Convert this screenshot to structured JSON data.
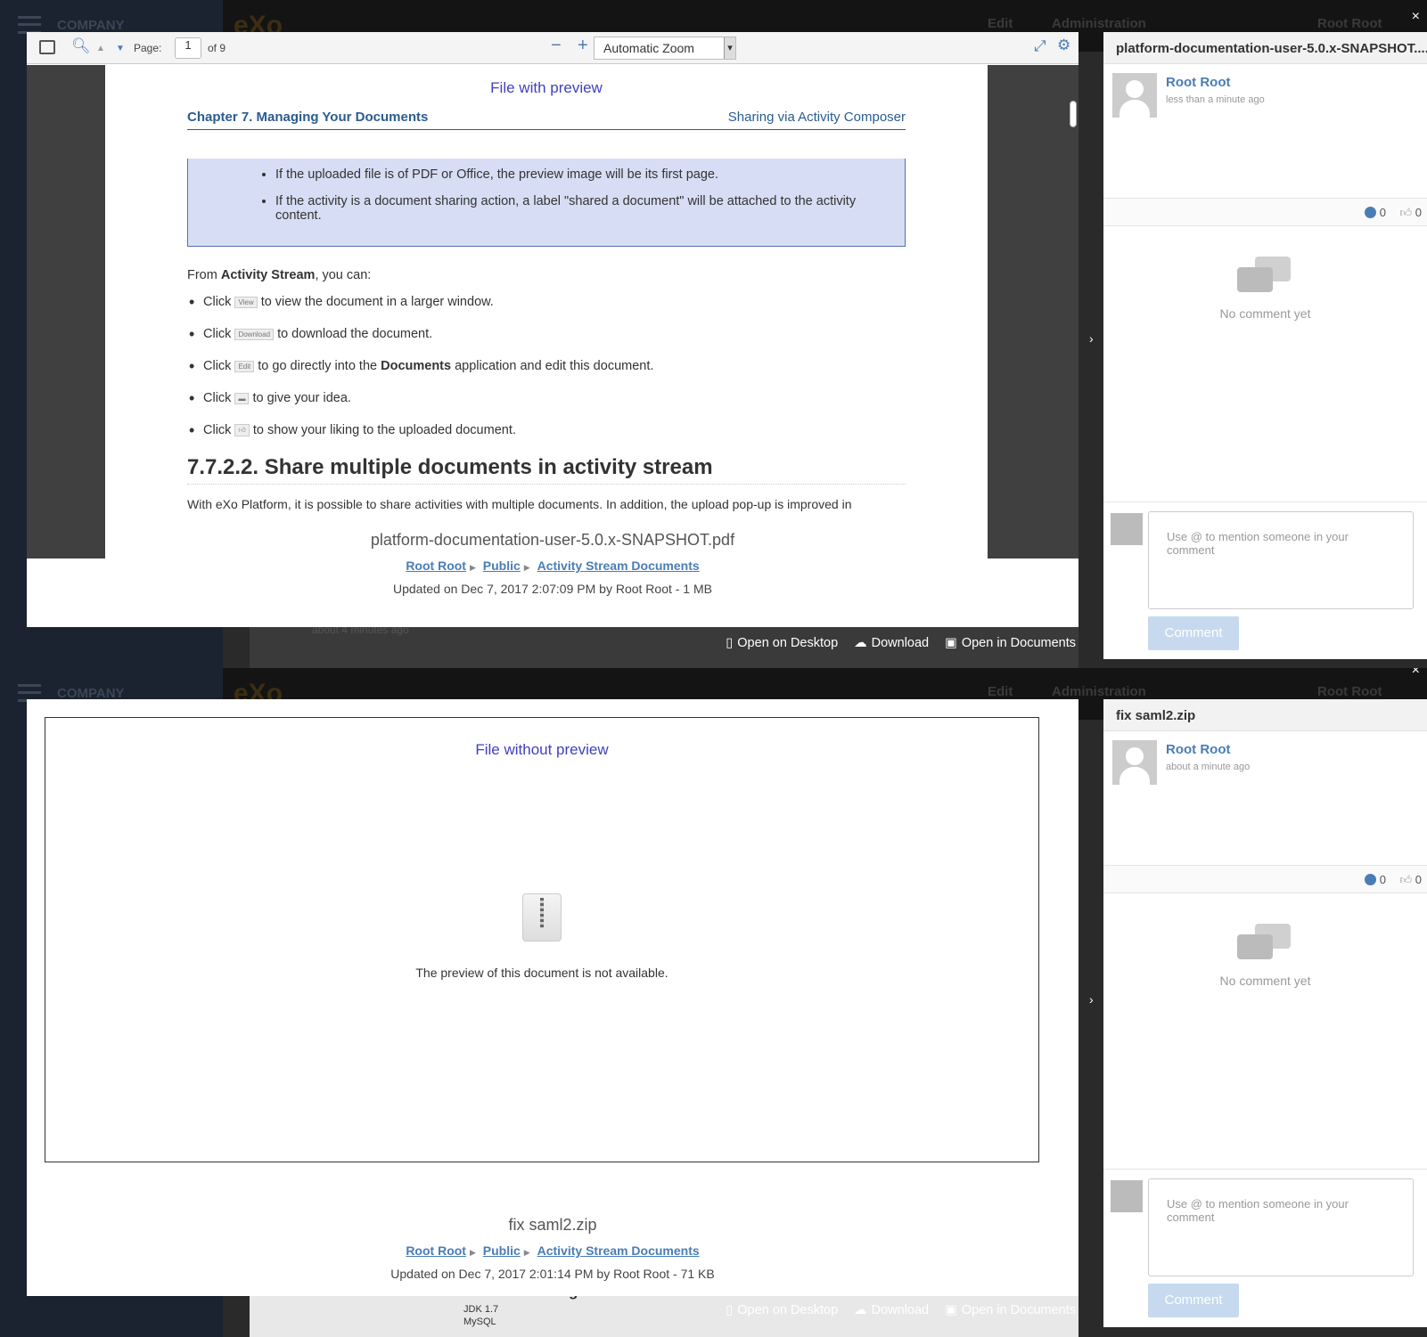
{
  "background": {
    "company": "COMPANY",
    "logo": "eXo",
    "nav": {
      "edit": "Edit",
      "administration": "Administration",
      "user": "Root Root"
    },
    "ghost_time": "about 4 minutes ago",
    "ghost_heading": "Tools and Technologies",
    "ghost_items": [
      "JDK 1.7",
      "MySQL"
    ]
  },
  "preview1": {
    "toolbar": {
      "page_label": "Page:",
      "page_value": "1",
      "page_total": "of 9",
      "zoom": "Automatic Zoom"
    },
    "doc": {
      "heading": "File with preview",
      "chapter": "Chapter 7. Managing Your Documents",
      "section_right": "Sharing via Activity Composer",
      "note_items": [
        "If the uploaded file is of PDF or Office, the preview image will be its first page.",
        "If the activity is a document sharing action, a label \"shared a document\" will be attached to the activity content."
      ],
      "intro_pre": "From ",
      "intro_bold": "Activity Stream",
      "intro_post": ", you can:",
      "click": "Click",
      "item_view_btn": "View",
      "item_view": "to view the document in a larger window.",
      "item_download_btn": "Download",
      "item_download": "to download the document.",
      "item_edit_btn": "Edit",
      "item_edit_pre": "to go directly into the ",
      "item_edit_bold": "Documents",
      "item_edit_post": " application and edit this document.",
      "item_idea": "to give your idea.",
      "item_like": "to show your liking to the uploaded document.",
      "section_title": "7.7.2.2. Share multiple documents in activity stream",
      "cut_text": "With eXo Platform, it is possible to share activities with multiple documents. In addition, the upload pop-up is improved in"
    },
    "file": {
      "name": "platform-documentation-user-5.0.x-SNAPSHOT.pdf",
      "breadcrumb": [
        "Root Root",
        "Public",
        "Activity Stream Documents"
      ],
      "updated": "Updated on Dec 7, 2017 2:07:09 PM by Root Root - 1 MB"
    },
    "side": {
      "title": "platform-documentation-user-5.0.x-SNAPSHOT....",
      "author": "Root Root",
      "time": "less than a minute ago",
      "comments": "0",
      "likes": "0",
      "no_comment": "No comment yet",
      "comment_placeholder": "Use @ to mention someone in your comment",
      "comment_button": "Comment"
    }
  },
  "preview2": {
    "heading": "File without preview",
    "message": "The preview of this document is not available.",
    "file": {
      "name": "fix saml2.zip",
      "breadcrumb": [
        "Root Root",
        "Public",
        "Activity Stream Documents"
      ],
      "updated": "Updated on Dec 7, 2017 2:01:14 PM by Root Root - 71 KB"
    },
    "side": {
      "title": "fix saml2.zip",
      "author": "Root Root",
      "time": "about a minute ago",
      "comments": "0",
      "likes": "0",
      "no_comment": "No comment yet",
      "comment_placeholder": "Use @ to mention someone in your comment",
      "comment_button": "Comment"
    }
  },
  "actions": {
    "open_desktop": "Open on Desktop",
    "download": "Download",
    "open_documents": "Open in Documents"
  },
  "icons": {
    "close": "×",
    "chevron": "›"
  }
}
